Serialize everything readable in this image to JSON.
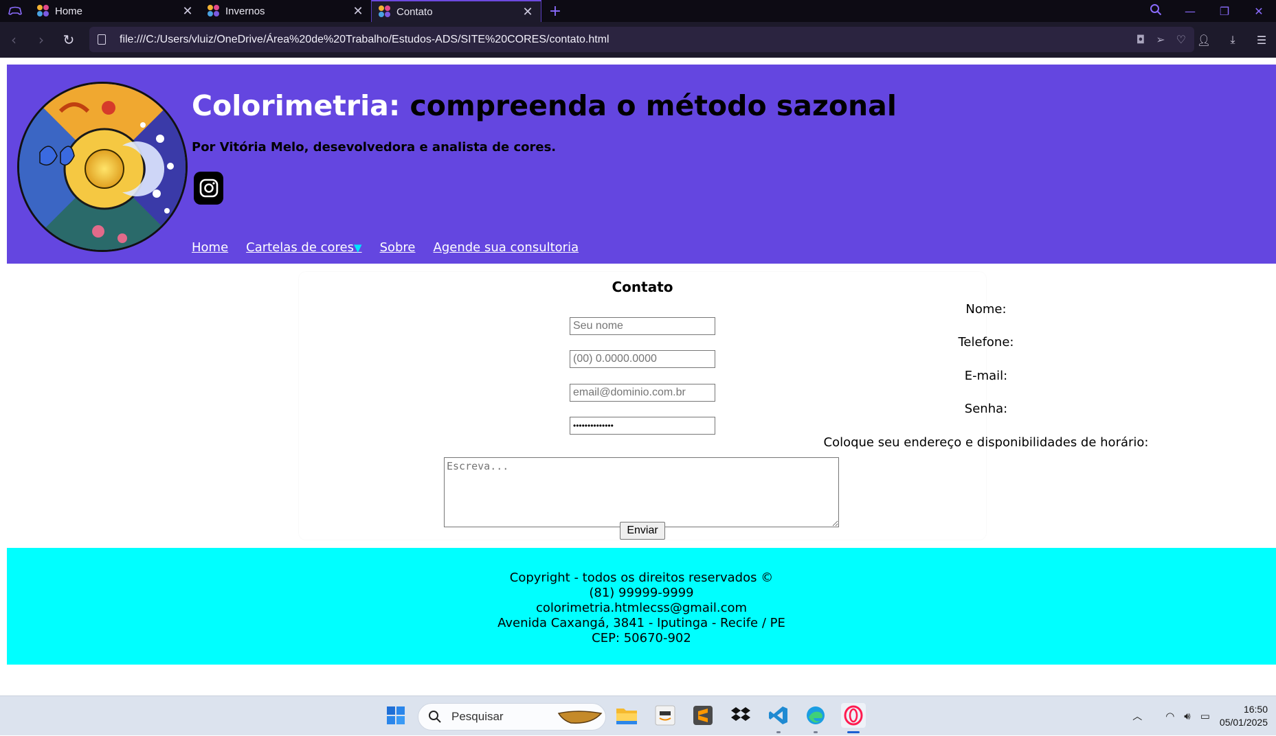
{
  "browser": {
    "tabs": [
      {
        "label": "Home",
        "active": false
      },
      {
        "label": "Invernos",
        "active": false
      },
      {
        "label": "Contato",
        "active": true
      }
    ],
    "new_tab_label": "+",
    "url": "file:///C:/Users/vluiz/OneDrive/Área%20de%20Trabalho/Estudos-ADS/SITE%20CORES/contato.html",
    "accent_color": "#6d4ae0"
  },
  "header": {
    "title_part1": "Colorimetria:",
    "title_part2": "compreenda o método sazonal",
    "author": "Por Vitória Melo, desevolvedora e analista de cores.",
    "background_color": "#6446e0",
    "social_icon": "instagram-icon",
    "nav": [
      {
        "label": "Home"
      },
      {
        "label": "Cartelas de cores",
        "has_dropdown": true
      },
      {
        "label": "Sobre"
      },
      {
        "label": "Agende sua consultoria"
      }
    ],
    "dropdown_caret": "▼"
  },
  "contact_form": {
    "heading": "Contato",
    "fields": [
      {
        "label": "Nome:",
        "placeholder": "Seu nome",
        "value": ""
      },
      {
        "label": "Telefone:",
        "placeholder": "(00) 0.0000.0000",
        "value": ""
      },
      {
        "label": "E-mail:",
        "placeholder": "email@dominio.com.br",
        "value": ""
      },
      {
        "label": "Senha:",
        "placeholder": "",
        "value": "••••••••••••••"
      }
    ],
    "textarea_label": "Coloque seu endereço e disponibilidades de horário:",
    "textarea_placeholder": "Escreva...",
    "submit_label": "Enviar"
  },
  "footer": {
    "copyright": "Copyright - todos os direitos reservados ©",
    "phone": "(81) 99999-9999",
    "email": "colorimetria.htmlecss@gmail.com",
    "address": "Avenida Caxangá, 3841 - Iputinga - Recife / PE",
    "cep": "CEP: 50670-902",
    "background_color": "#00ffff"
  },
  "taskbar": {
    "search_label": "Pesquisar",
    "time": "16:50",
    "date": "05/01/2025",
    "apps": [
      "windows-start-icon",
      "file-explorer-icon",
      "amazon-icon",
      "sublime-text-icon",
      "dropbox-icon",
      "vscode-icon",
      "edge-icon",
      "opera-gx-icon"
    ]
  }
}
